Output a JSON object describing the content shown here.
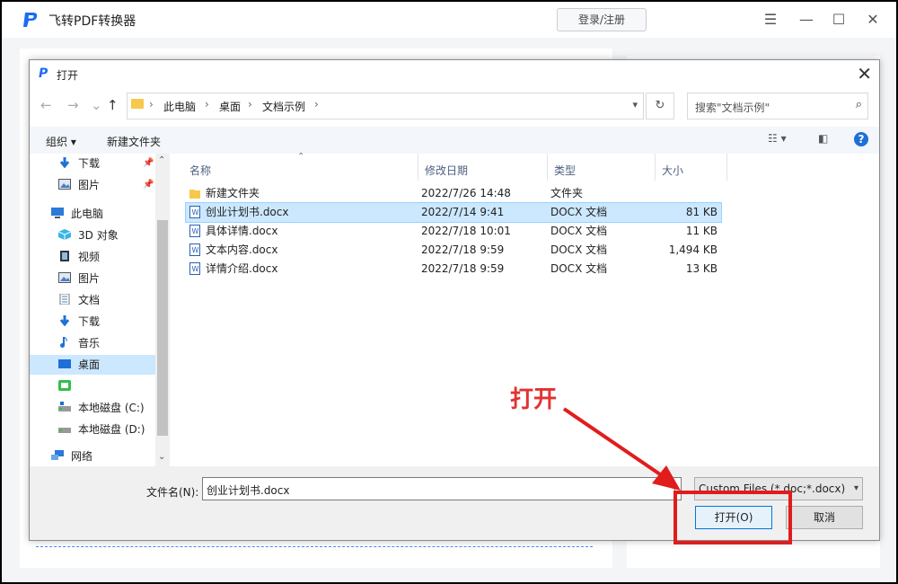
{
  "app": {
    "title": "飞转PDF转换器",
    "login_label": "登录/注册",
    "menu_icon": "menu-icon",
    "min_icon": "minimize-icon",
    "max_icon": "maximize-icon",
    "close_icon": "close-icon"
  },
  "dialog": {
    "title": "打开",
    "close_glyph": "✕",
    "breadcrumb": [
      "此电脑",
      "桌面",
      "文档示例"
    ],
    "search_placeholder": "搜索\"文档示例\"",
    "toolbar": {
      "organize": "组织 ▾",
      "new_folder": "新建文件夹"
    },
    "sidebar": [
      {
        "label": "下载",
        "icon": "download-icon",
        "pinned": true
      },
      {
        "label": "图片",
        "icon": "pictures-icon",
        "pinned": true
      },
      {
        "label": "此电脑",
        "icon": "computer-icon"
      },
      {
        "label": "3D 对象",
        "icon": "3d-objects-icon"
      },
      {
        "label": "视频",
        "icon": "video-icon"
      },
      {
        "label": "图片",
        "icon": "pictures-icon"
      },
      {
        "label": "文档",
        "icon": "documents-icon"
      },
      {
        "label": "下载",
        "icon": "download-icon"
      },
      {
        "label": "音乐",
        "icon": "music-icon"
      },
      {
        "label": "桌面",
        "icon": "desktop-icon",
        "selected": true
      },
      {
        "label": "",
        "icon": "app-drive-icon"
      },
      {
        "label": "本地磁盘 (C:)",
        "icon": "drive-icon"
      },
      {
        "label": "本地磁盘 (D:)",
        "icon": "drive-icon"
      },
      {
        "label": "网络",
        "icon": "network-icon"
      }
    ],
    "columns": [
      "名称",
      "修改日期",
      "类型",
      "大小"
    ],
    "files": [
      {
        "name": "新建文件夹",
        "date": "2022/7/26 14:48",
        "type": "文件夹",
        "size": "",
        "icon": "folder-icon"
      },
      {
        "name": "创业计划书.docx",
        "date": "2022/7/14 9:41",
        "type": "DOCX 文档",
        "size": "81 KB",
        "icon": "docx-icon",
        "selected": true
      },
      {
        "name": "具体详情.docx",
        "date": "2022/7/18 10:01",
        "type": "DOCX 文档",
        "size": "11 KB",
        "icon": "docx-icon"
      },
      {
        "name": "文本内容.docx",
        "date": "2022/7/18 9:59",
        "type": "DOCX 文档",
        "size": "1,494 KB",
        "icon": "docx-icon"
      },
      {
        "name": "详情介绍.docx",
        "date": "2022/7/18 9:59",
        "type": "DOCX 文档",
        "size": "13 KB",
        "icon": "docx-icon"
      }
    ],
    "filename_label": "文件名(N):",
    "filename_value": "创业计划书.docx",
    "filetype_value": "Custom Files (*.doc;*.docx)",
    "open_label": "打开(O)",
    "cancel_label": "取消"
  },
  "annotation": {
    "text": "打开",
    "color": "#e11c1c"
  }
}
